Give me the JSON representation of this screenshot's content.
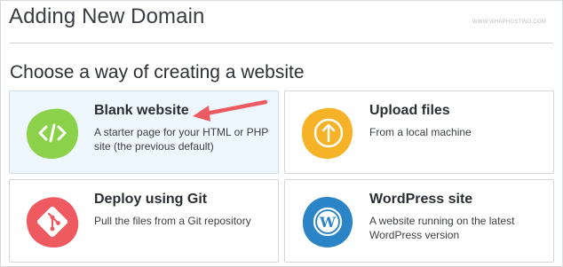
{
  "header": {
    "title": "Adding New Domain",
    "watermark": "WWW.WHAPHOSTING.COM"
  },
  "section": {
    "title": "Choose a way of creating a website"
  },
  "options": [
    {
      "title": "Blank website",
      "description": "A starter page for your HTML or PHP site (the previous default)",
      "icon": "code-icon",
      "color": "#8bd14a",
      "selected": true
    },
    {
      "title": "Upload files",
      "description": "From a local machine",
      "icon": "upload-icon",
      "color": "#f7b327",
      "selected": false
    },
    {
      "title": "Deploy using Git",
      "description": "Pull the files from a Git repository",
      "icon": "git-icon",
      "color": "#ee5a60",
      "selected": false
    },
    {
      "title": "WordPress site",
      "description": "A website running on the latest WordPress version",
      "icon": "wordpress-icon",
      "color": "#2a84c6",
      "selected": false
    }
  ],
  "annotation": {
    "icon": "red-arrow-icon",
    "color": "#ec5b61"
  }
}
